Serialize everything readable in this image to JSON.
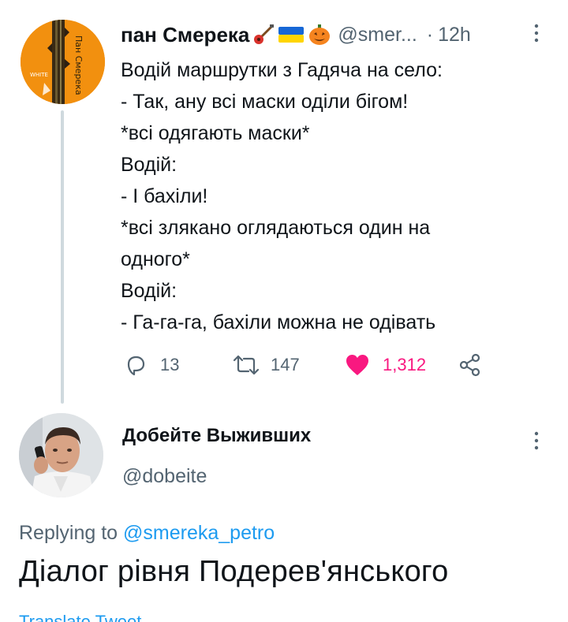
{
  "tweet": {
    "author": {
      "name": "пан Смерека",
      "handle": "@smer...",
      "avatar_icon": "orange-avatar-icon"
    },
    "separator": "·",
    "time": "12h",
    "emojis": [
      "guitar-emoji",
      "ukraine-flag-emoji",
      "pumpkin-emoji"
    ],
    "lines": [
      "Водій маршрутки з Гадяча на село:",
      "- Так, ану всі маски оділи бігом!",
      "*всі одягають маски*",
      "Водій:",
      "- І бахіли!",
      "*всі злякано оглядаються один на",
      "одного*",
      "Водій:",
      "- Га-га-га, бахіли можна не одівать"
    ],
    "actions": {
      "replies": "13",
      "retweets": "147",
      "likes": "1,312"
    }
  },
  "reply": {
    "author": {
      "name": "Добейте Выживших",
      "handle": "@dobeite",
      "avatar_icon": "man-on-phone-avatar"
    },
    "replying_to_label": "Replying to",
    "replying_to_handle": "@smereka_petro",
    "text": "Діалог рівня Подерев'янського",
    "translate_label": "Translate Tweet"
  },
  "colors": {
    "text_primary": "#0f1419",
    "text_secondary": "#536471",
    "link": "#1d9bf0",
    "like": "#f91880",
    "thread_line": "#cfd9de"
  }
}
